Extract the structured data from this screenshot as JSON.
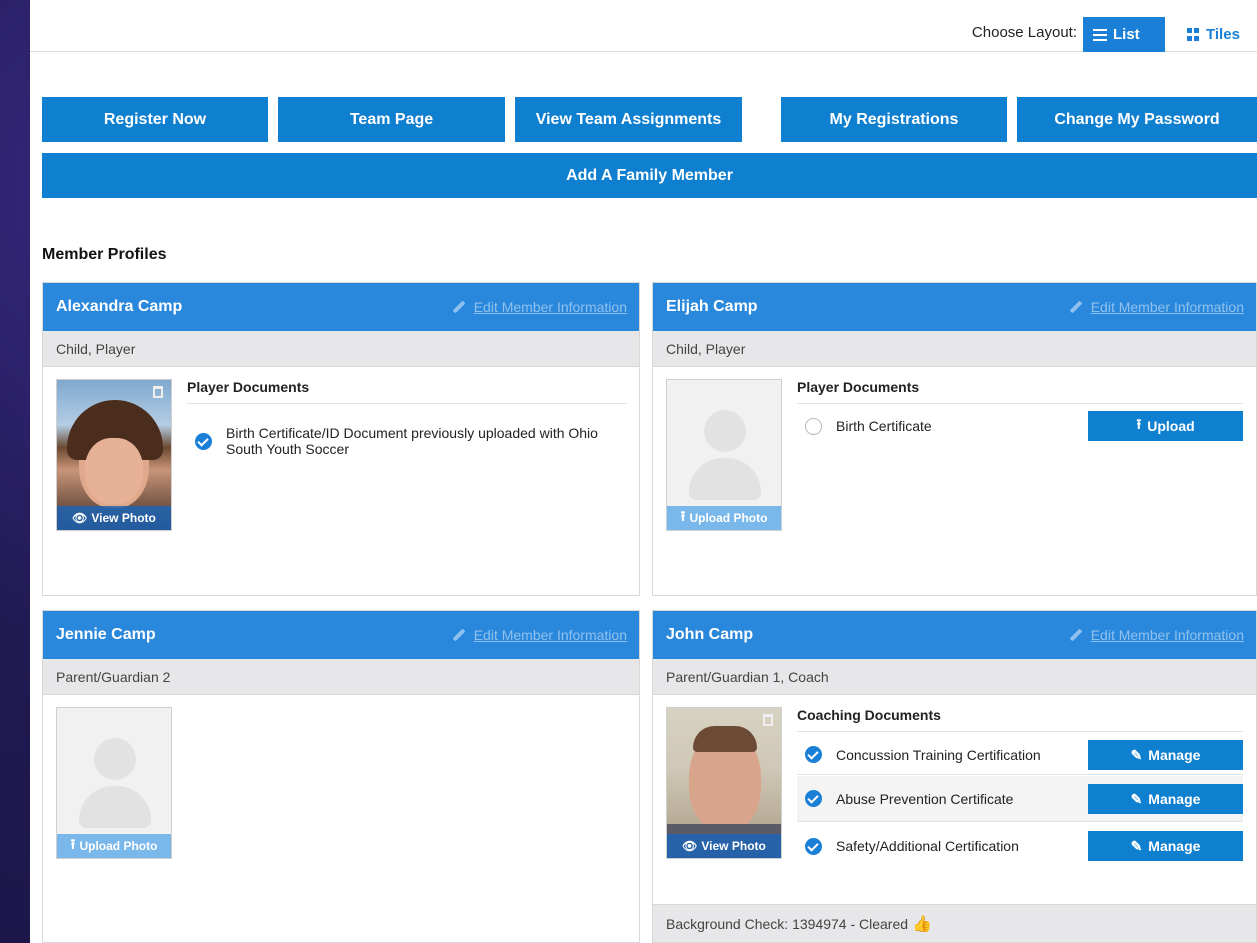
{
  "layout": {
    "label": "Choose Layout:",
    "list_label": "List",
    "tiles_label": "Tiles"
  },
  "nav": {
    "register": "Register Now",
    "team_page": "Team Page",
    "team_assignments": "View Team Assignments",
    "my_registrations": "My Registrations",
    "change_password": "Change My Password",
    "add_family": "Add A Family Member"
  },
  "section_title": "Member Profiles",
  "edit_label": "Edit Member Information",
  "photo": {
    "view": "View Photo",
    "upload": "Upload Photo"
  },
  "members": [
    {
      "name": "Alexandra Camp",
      "role": "Child, Player",
      "docs_title": "Player Documents",
      "docs": [
        {
          "label": "Birth Certificate/ID Document previously uploaded with Ohio South Youth Soccer",
          "status": "complete"
        }
      ]
    },
    {
      "name": "Elijah Camp",
      "role": "Child, Player",
      "docs_title": "Player Documents",
      "docs": [
        {
          "label": "Birth Certificate",
          "status": "missing",
          "action": "Upload"
        }
      ]
    },
    {
      "name": "Jennie Camp",
      "role": "Parent/Guardian 2"
    },
    {
      "name": "John Camp",
      "role": "Parent/Guardian 1, Coach",
      "docs_title": "Coaching Documents",
      "docs": [
        {
          "label": "Concussion Training Certification",
          "status": "complete",
          "action": "Manage"
        },
        {
          "label": "Abuse Prevention Certificate",
          "status": "complete",
          "action": "Manage"
        },
        {
          "label": "Safety/Additional Certification",
          "status": "complete",
          "action": "Manage"
        }
      ],
      "background_check": "Background Check: 1394974 - Cleared"
    }
  ],
  "colors": {
    "primary": "#0f7fcf",
    "header": "#2a88dc",
    "success": "#3fb618"
  }
}
